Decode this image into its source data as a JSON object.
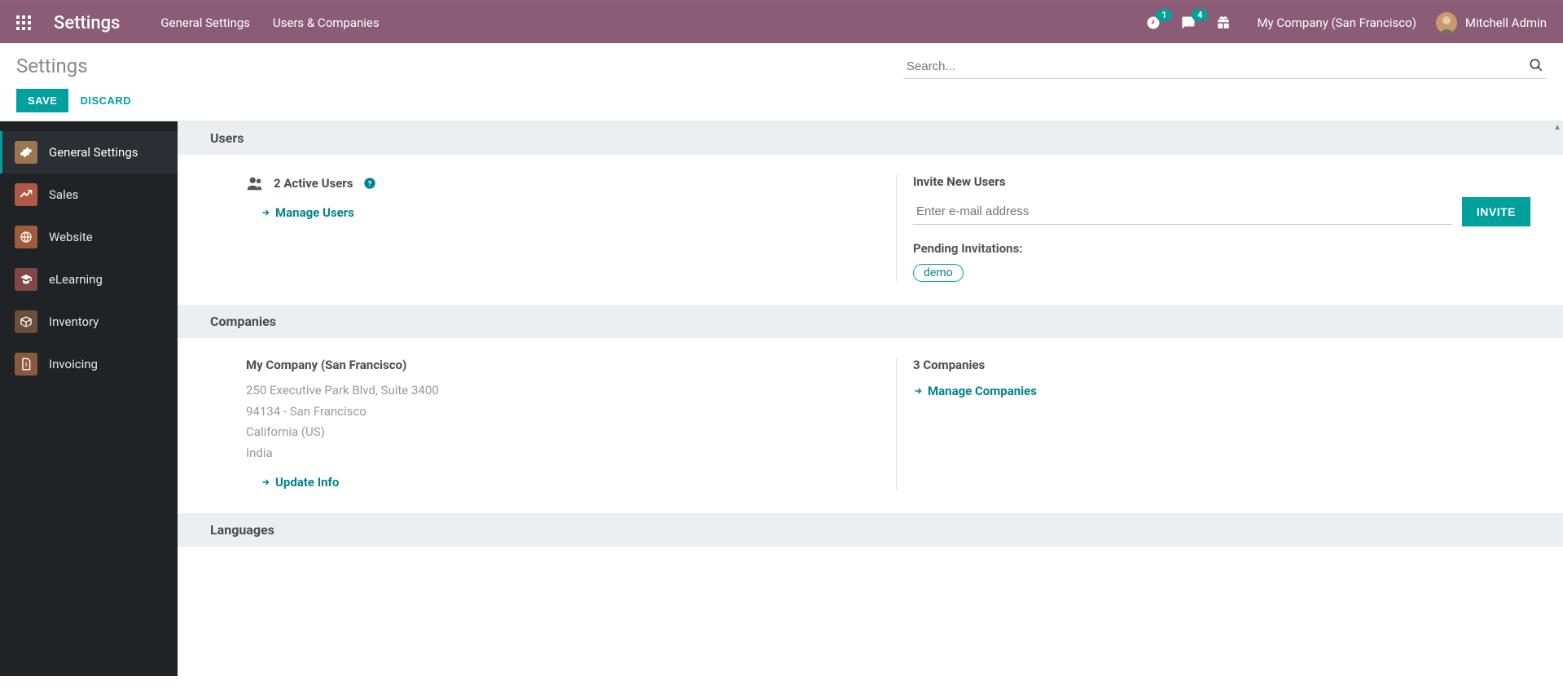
{
  "navbar": {
    "brand": "Settings",
    "menu": [
      "General Settings",
      "Users & Companies"
    ],
    "clock_badge": "1",
    "chat_badge": "4",
    "company": "My Company (San Francisco)",
    "user": "Mitchell Admin"
  },
  "subheader": {
    "title": "Settings",
    "save": "SAVE",
    "discard": "DISCARD",
    "search_placeholder": "Search..."
  },
  "sidebar": {
    "items": [
      {
        "label": "General Settings"
      },
      {
        "label": "Sales"
      },
      {
        "label": "Website"
      },
      {
        "label": "eLearning"
      },
      {
        "label": "Inventory"
      },
      {
        "label": "Invoicing"
      }
    ]
  },
  "sections": {
    "users": {
      "title": "Users",
      "active_count": "2 Active Users",
      "manage": "Manage Users",
      "invite_heading": "Invite New Users",
      "invite_placeholder": "Enter e-mail address",
      "invite_button": "INVITE",
      "pending_label": "Pending Invitations:",
      "pending_tags": [
        "demo"
      ]
    },
    "companies": {
      "title": "Companies",
      "name": "My Company (San Francisco)",
      "address_line1": "250 Executive Park Blvd, Suite 3400",
      "address_line2": "94134 - San Francisco",
      "address_line3": "California (US)",
      "address_line4": "India",
      "update_info": "Update Info",
      "count_label": "3 Companies",
      "manage": "Manage Companies"
    },
    "languages": {
      "title": "Languages"
    }
  }
}
